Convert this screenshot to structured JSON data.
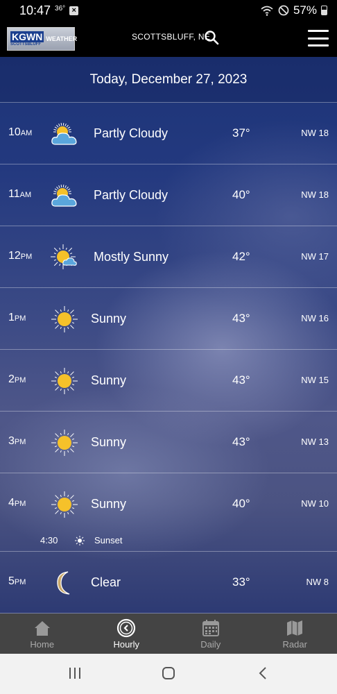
{
  "status_bar": {
    "time": "10:47",
    "temp": "36°",
    "battery": "57%"
  },
  "header": {
    "logo_call": "KGWN",
    "logo_label": "WEATHER",
    "logo_sub": "SCOTTSBLUFF",
    "location": "SCOTTSBLUFF, NE"
  },
  "date_label": "Today, December 27, 2023",
  "hours": [
    {
      "hour": "10",
      "ampm": "AM",
      "icon": "partly-cloudy-icon",
      "condition": "Partly Cloudy",
      "temp": "37°",
      "wind": "NW 18"
    },
    {
      "hour": "11",
      "ampm": "AM",
      "icon": "partly-cloudy-icon",
      "condition": "Partly Cloudy",
      "temp": "40°",
      "wind": "NW 18"
    },
    {
      "hour": "12",
      "ampm": "PM",
      "icon": "mostly-sunny-icon",
      "condition": "Mostly Sunny",
      "temp": "42°",
      "wind": "NW 17"
    },
    {
      "hour": "1",
      "ampm": "PM",
      "icon": "sunny-icon",
      "condition": "Sunny",
      "temp": "43°",
      "wind": "NW 16"
    },
    {
      "hour": "2",
      "ampm": "PM",
      "icon": "sunny-icon",
      "condition": "Sunny",
      "temp": "43°",
      "wind": "NW 15"
    },
    {
      "hour": "3",
      "ampm": "PM",
      "icon": "sunny-icon",
      "condition": "Sunny",
      "temp": "43°",
      "wind": "NW 13"
    },
    {
      "hour": "4",
      "ampm": "PM",
      "icon": "sunny-icon",
      "condition": "Sunny",
      "temp": "40°",
      "wind": "NW 10"
    },
    {
      "hour": "5",
      "ampm": "PM",
      "icon": "moon-icon",
      "condition": "Clear",
      "temp": "33°",
      "wind": "NW 8"
    }
  ],
  "sunset": {
    "time": "4:30",
    "label": "Sunset"
  },
  "nav": [
    {
      "label": "Home",
      "icon": "home-icon"
    },
    {
      "label": "Hourly",
      "icon": "clock-icon"
    },
    {
      "label": "Daily",
      "icon": "calendar-icon"
    },
    {
      "label": "Radar",
      "icon": "map-icon"
    }
  ],
  "colors": {
    "sun": "#f5c12a",
    "cloud": "#5aa6dc",
    "moon": "#c9a86a",
    "nav_bg": "#444444"
  }
}
